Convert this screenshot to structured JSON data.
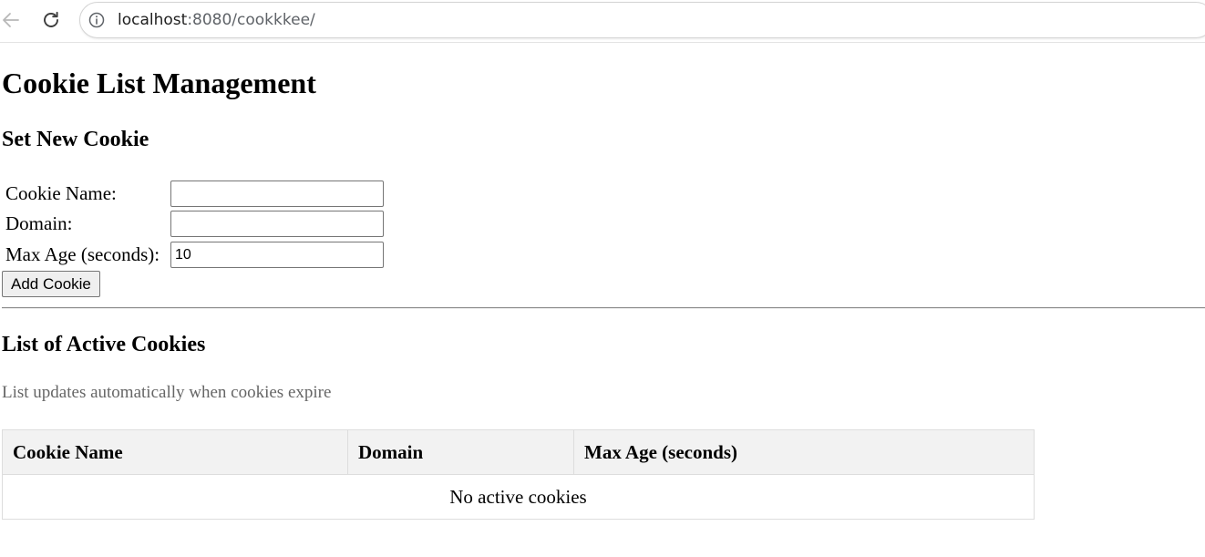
{
  "browser": {
    "url_host": "localhost",
    "url_rest": ":8080/cookkkee/",
    "icons": {
      "back": "back-arrow-icon",
      "reload": "reload-icon",
      "site_info": "info-icon"
    }
  },
  "page": {
    "title": "Cookie List Management",
    "set_section_title": "Set New Cookie",
    "form": {
      "name_label": "Cookie Name:",
      "name_value": "",
      "domain_label": "Domain:",
      "domain_value": "",
      "max_age_label": "Max Age (seconds):",
      "max_age_value": "10",
      "submit_label": "Add Cookie"
    },
    "list_section_title": "List of Active Cookies",
    "list_hint": "List updates automatically when cookies expire",
    "table": {
      "headers": [
        "Cookie Name",
        "Domain",
        "Max Age (seconds)"
      ],
      "empty_message": "No active cookies"
    }
  },
  "colors": {
    "hint_text": "#666666",
    "table_header_bg": "#f2f2f2",
    "table_border": "#dddddd"
  }
}
